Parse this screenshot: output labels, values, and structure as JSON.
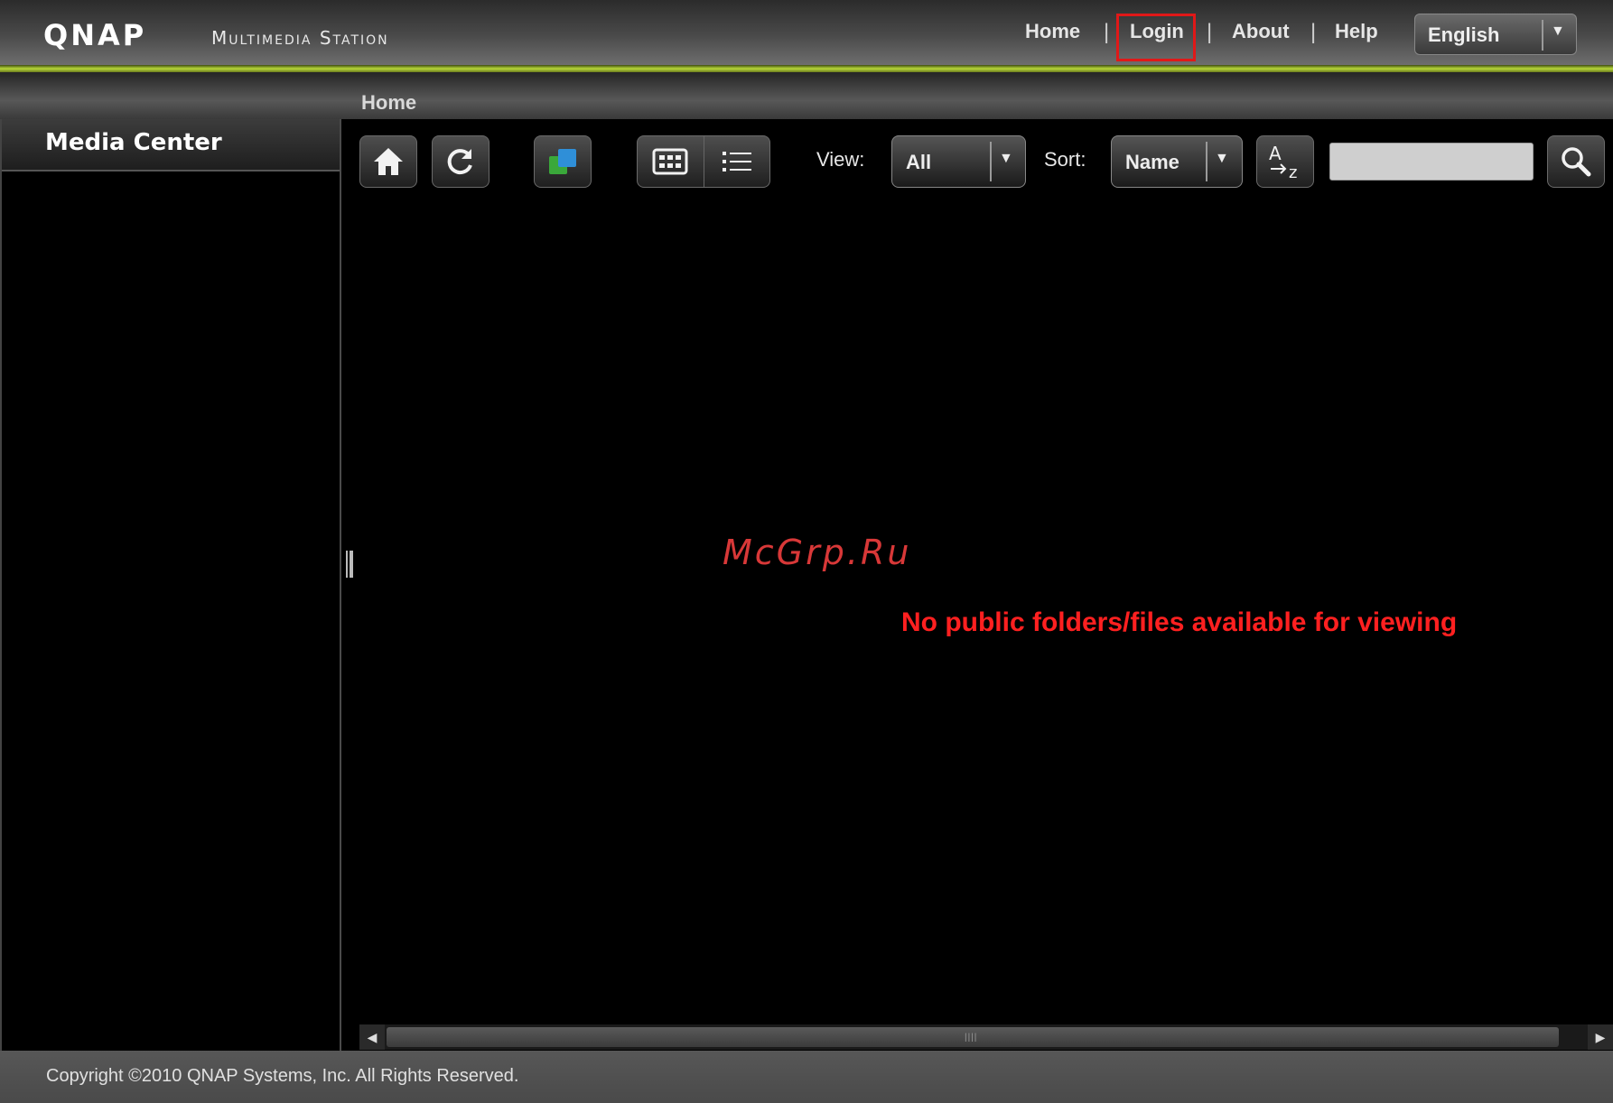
{
  "header": {
    "logo": "QNAP",
    "subtitle": "Multimedia Station",
    "nav": {
      "home": "Home",
      "login": "Login",
      "about": "About",
      "help": "Help",
      "separator": "|"
    },
    "language": "English"
  },
  "breadcrumb": "Home",
  "sidebar": {
    "title": "Media Center"
  },
  "toolbar": {
    "view_label": "View:",
    "view_value": "All",
    "sort_label": "Sort:",
    "sort_value": "Name",
    "search_value": "",
    "icons": [
      "home-icon",
      "refresh-icon",
      "slideshow-icon",
      "thumbnail-view-icon",
      "list-view-icon",
      "sort-az-icon",
      "search-icon"
    ]
  },
  "main": {
    "watermark": "McGrp.Ru",
    "empty_message": "No public folders/files available for viewing"
  },
  "footer": {
    "copyright": "Copyright ©2010 QNAP Systems, Inc. All Rights Reserved."
  },
  "colors": {
    "highlight_box": "#e01818",
    "accent_line": "#b8d83a",
    "message": "#ff2020"
  }
}
